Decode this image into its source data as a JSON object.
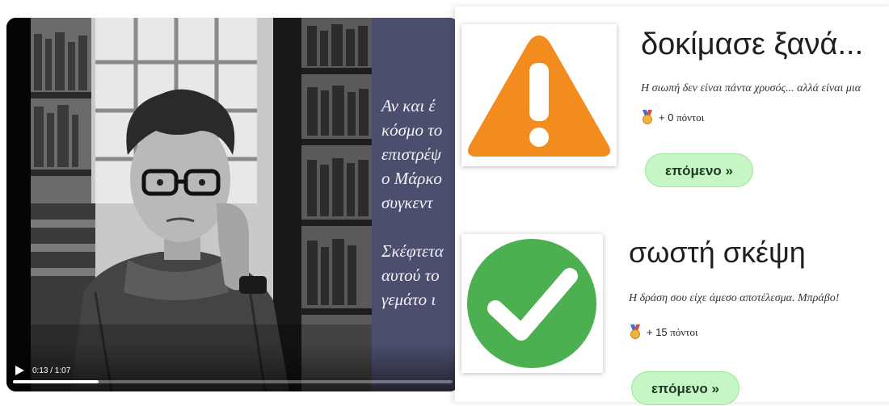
{
  "video": {
    "narration_para1": [
      "Αν και έ",
      "κόσμο το",
      "επιστρέψ",
      "ο Μάρκο",
      "συγκεντ"
    ],
    "narration_para2": [
      "Σκέφτετα",
      "αυτού το",
      "γεμάτο ι"
    ],
    "time": "0:13 / 1:07",
    "progress": 0.194,
    "play_icon": "play-icon"
  },
  "results": [
    {
      "icon": "warning-icon",
      "icon_color": "#F28C1E",
      "title": "δοκίμασε ξανά...",
      "message": "Η σιωπή δεν είναι πάντα χρυσός... αλλά είναι μια",
      "points_value": "+ 0",
      "points_word": "πόντοι",
      "next_label": "επόμενο »"
    },
    {
      "icon": "checkmark-icon",
      "icon_color": "#4CAF50",
      "title": "σωστή σκέψη",
      "message": "Η δράση σου είχε άμεσο αποτέλεσμα. Μπράβο!",
      "points_value": "+ 15",
      "points_word": "πόντοι",
      "next_label": "επόμενο »"
    }
  ],
  "colors": {
    "next_button_bg": "#C6F5C6",
    "text_panel": "#4B4F6D"
  }
}
